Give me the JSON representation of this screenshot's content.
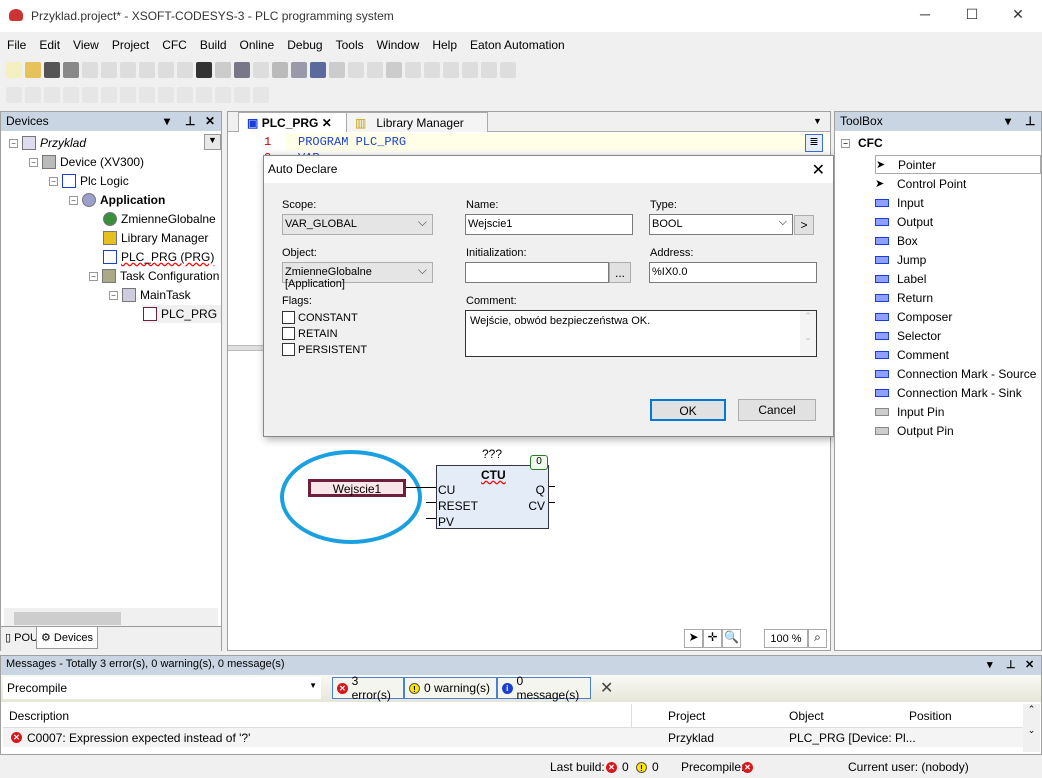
{
  "window": {
    "title": "Przyklad.project* - XSOFT-CODESYS-3 - PLC programming system",
    "minimize": "─",
    "maximize": "☐",
    "close": "✕"
  },
  "menu": [
    "File",
    "Edit",
    "View",
    "Project",
    "CFC",
    "Build",
    "Online",
    "Debug",
    "Tools",
    "Window",
    "Help",
    "Eaton Automation"
  ],
  "devices": {
    "title": "Devices",
    "tree": [
      {
        "label": "Przyklad",
        "icon": "project-icon",
        "italic": true
      },
      {
        "label": "Device (XV300)",
        "icon": "device-icon"
      },
      {
        "label": "Plc Logic",
        "icon": "plc-logic-icon"
      },
      {
        "label": "Application",
        "icon": "gear-icon",
        "bold": true
      },
      {
        "label": "ZmienneGlobalne",
        "icon": "globe-icon"
      },
      {
        "label": "Library Manager",
        "icon": "books-icon"
      },
      {
        "label": "PLC_PRG (PRG)",
        "icon": "pou-icon"
      },
      {
        "label": "Task Configuration",
        "icon": "task-config-icon"
      },
      {
        "label": "MainTask",
        "icon": "task-icon"
      },
      {
        "label": "PLC_PRG",
        "icon": "program-call-icon"
      }
    ],
    "tabs": [
      "POUs",
      "Devices"
    ]
  },
  "editor": {
    "tabs": [
      "PLC_PRG",
      "Library Manager"
    ],
    "lines": [
      {
        "num": "1",
        "code": "PROGRAM PLC_PRG"
      },
      {
        "num": "2",
        "code": "VAR"
      }
    ],
    "cfc": {
      "input": "Wejscie1",
      "block": {
        "instance": "???",
        "type": "CTU",
        "order": "0",
        "inputs": [
          "CU",
          "RESET",
          "PV"
        ],
        "outputs": [
          "Q",
          "CV"
        ]
      }
    },
    "zoom": "100 %"
  },
  "dialog": {
    "title": "Auto Declare",
    "scope_label": "Scope:",
    "scope": "VAR_GLOBAL",
    "name_label": "Name:",
    "name": "Wejscie1",
    "type_label": "Type:",
    "type": "BOOL",
    "type_btn": ">",
    "object_label": "Object:",
    "object": "ZmienneGlobalne [Application]",
    "init_label": "Initialization:",
    "init": "",
    "init_btn": "...",
    "address_label": "Address:",
    "address": "%IX0.0",
    "flags_label": "Flags:",
    "flags": [
      {
        "label": "CONSTANT",
        "checked": false
      },
      {
        "label": "RETAIN",
        "checked": false
      },
      {
        "label": "PERSISTENT",
        "checked": false
      }
    ],
    "comment_label": "Comment:",
    "comment": "Wejście, obwód bezpieczeństwa OK.",
    "ok": "OK",
    "cancel": "Cancel"
  },
  "toolbox": {
    "title": "ToolBox",
    "category": "CFC",
    "items": [
      "Pointer",
      "Control Point",
      "Input",
      "Output",
      "Box",
      "Jump",
      "Label",
      "Return",
      "Composer",
      "Selector",
      "Comment",
      "Connection Mark - Source",
      "Connection Mark - Sink",
      "Input Pin",
      "Output Pin"
    ]
  },
  "messages": {
    "title": "Messages - Totally 3 error(s), 0 warning(s), 0 message(s)",
    "source": "Precompile",
    "errors": "3 error(s)",
    "warnings": "0 warning(s)",
    "infos": "0 message(s)",
    "columns": [
      "Description",
      "Project",
      "Object",
      "Position"
    ],
    "rows": [
      {
        "description": "C0007:  Expression expected instead of '?'",
        "project": "Przyklad",
        "object": "PLC_PRG [Device: Pl...",
        "position": ""
      }
    ]
  },
  "status": {
    "last_build": "Last build:",
    "errors": "0",
    "warnings": "0",
    "precompile": "Precompile:",
    "user": "Current user: (nobody)"
  },
  "colors": {
    "panel_header": "#c9d5e2",
    "highlight_ellipse": "#1a9fe0",
    "input_border": "#6e1f3c",
    "block_fill": "#e4ecf7"
  }
}
